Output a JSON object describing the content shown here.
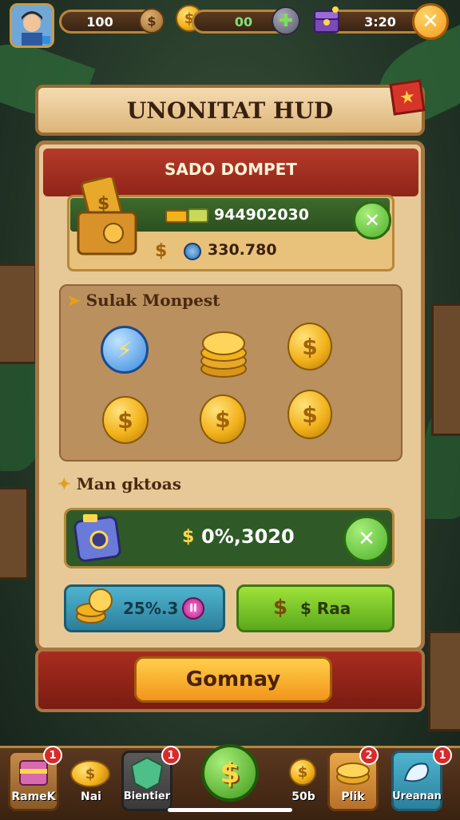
{
  "top_bar": {
    "counter_1": "100",
    "counter_2": "00",
    "counter_3": "3:20"
  },
  "panel": {
    "title": "UNONITAT HUD",
    "subtitle": "SADO DOMPET",
    "wallet_value_1": "944902030",
    "wallet_value_2": "330.780",
    "section_1_label": "Sulak Monpest",
    "section_2_label": "Man gktoas",
    "reward_value": "0%,3020",
    "blue_button_label": "25%.3",
    "green_button_label": "$ Raa",
    "confirm_button_label": "Gomnay"
  },
  "bottom_nav": {
    "items": [
      {
        "label": "RameK",
        "badge": "1"
      },
      {
        "label": "Nai"
      },
      {
        "label": "Bientier",
        "badge": "1"
      },
      {
        "label": "$"
      },
      {
        "label": "50b"
      },
      {
        "label": "Plik",
        "badge": "2"
      },
      {
        "label": "Ureanan",
        "badge": "1"
      }
    ]
  },
  "colors": {
    "panel_bg": "#e6c996",
    "red_band": "#b63a2a",
    "green_bar": "#2f5a28",
    "coin_gold": "#f2b21c",
    "button_orange": "#f2951c"
  }
}
